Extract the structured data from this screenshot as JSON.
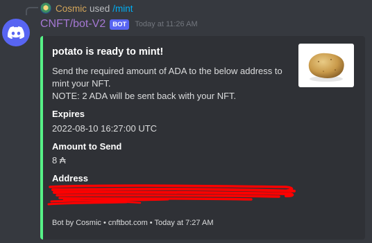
{
  "reply": {
    "username": "Cosmic",
    "used_text": "used",
    "command": "/mint"
  },
  "message": {
    "username": "CNFT/bot-V2",
    "bot_tag": "BOT",
    "timestamp": "Today at 11:26 AM"
  },
  "embed": {
    "accent_color": "#57f287",
    "title": "potato is ready to mint!",
    "description_line1": "Send the required amount of ADA to the below address to mint your NFT.",
    "description_line2": "NOTE: 2 ADA will be sent back with your NFT.",
    "fields": [
      {
        "name": "Expires",
        "value": "2022-08-10 16:27:00 UTC"
      },
      {
        "name": "Amount to Send",
        "value": "8 ₳"
      },
      {
        "name": "Address",
        "value": ""
      }
    ],
    "footer": "Bot by Cosmic • cnftbot.com • Today at 7:27 AM"
  }
}
